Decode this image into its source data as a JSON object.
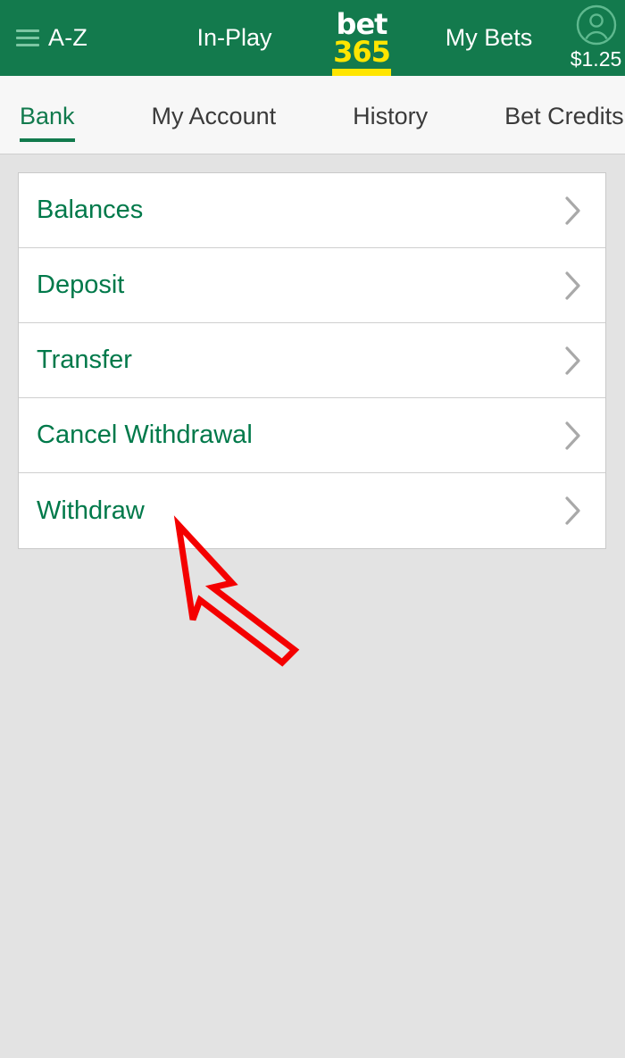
{
  "header": {
    "menu_label": "A-Z",
    "menu_icon": "hamburger-icon",
    "inplay_label": "In-Play",
    "logo_top": "bet",
    "logo_bottom": "365",
    "mybets_label": "My Bets",
    "account_icon": "user-avatar-icon",
    "balance": "$1.25",
    "bg_color": "#137a4d",
    "accent_color": "#ffe500"
  },
  "tabs": [
    {
      "label": "Bank",
      "active": true
    },
    {
      "label": "My Account",
      "active": false
    },
    {
      "label": "History",
      "active": false
    },
    {
      "label": "Bet Credits",
      "active": false
    }
  ],
  "bank_menu": {
    "items": [
      {
        "label": "Balances",
        "chevron": "chevron-right-icon"
      },
      {
        "label": "Deposit",
        "chevron": "chevron-right-icon"
      },
      {
        "label": "Transfer",
        "chevron": "chevron-right-icon"
      },
      {
        "label": "Cancel Withdrawal",
        "chevron": "chevron-right-icon"
      },
      {
        "label": "Withdraw",
        "chevron": "chevron-right-icon"
      }
    ],
    "link_color": "#00794a"
  },
  "annotation": {
    "type": "arrow",
    "color": "#f40000",
    "points_to": "Withdraw"
  }
}
